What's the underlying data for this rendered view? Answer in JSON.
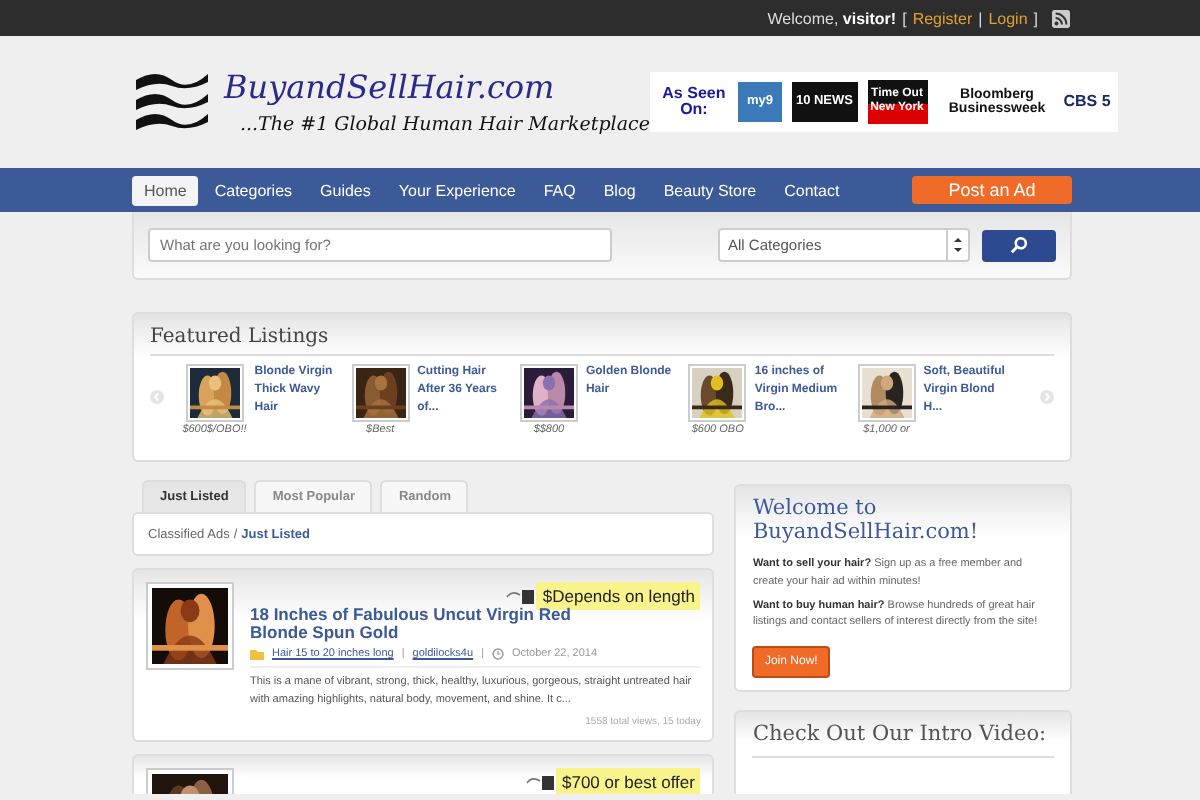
{
  "top_bar": {
    "welcome": "Welcome, **visitor!**",
    "open_bracket": "[",
    "register": "Register",
    "separator": "|",
    "login": "Login",
    "close_bracket": "]"
  },
  "header": {
    "logo_title": "BuyandSellHair.com",
    "tagline": "...The #1 Global Human Hair Marketplace",
    "as_seen_on": "As Seen On:",
    "media_logos": [
      {
        "kind": "my9",
        "text": "my9"
      },
      {
        "kind": "news",
        "text": "10 NEWS"
      },
      {
        "kind": "timeout",
        "text": "Time Out New York"
      },
      {
        "kind": "bloomberg",
        "text": "Bloomberg Businessweek"
      },
      {
        "kind": "cbs",
        "text": "CBS 5"
      }
    ]
  },
  "nav": {
    "items": [
      {
        "label": "Home",
        "selected": true
      },
      {
        "label": "Categories",
        "selected": false
      },
      {
        "label": "Guides",
        "selected": false
      },
      {
        "label": "Your Experience",
        "selected": false
      },
      {
        "label": "FAQ",
        "selected": false
      },
      {
        "label": "Blog",
        "selected": false
      },
      {
        "label": "Beauty Store",
        "selected": false
      },
      {
        "label": "Contact",
        "selected": false
      }
    ],
    "post_ad": "Post an Ad"
  },
  "search": {
    "placeholder": "What are you looking for?",
    "category": "All Categories"
  },
  "featured": {
    "title": "Featured Listings",
    "items": [
      {
        "title": "Blonde Virgin Thick Wavy Hair",
        "price": "$600$/OBO!!"
      },
      {
        "title": "Cutting Hair After 36 Years of...",
        "price": "$Best"
      },
      {
        "title": "Golden Blonde Hair",
        "price": "$$800"
      },
      {
        "title": "16 inches of Virgin Medium Bro...",
        "price": "$600 OBO"
      },
      {
        "title": "Soft, Beautiful Virgin Blond H...",
        "price": "$1,000 or"
      }
    ]
  },
  "tabs": [
    {
      "label": "Just Listed",
      "selected": true
    },
    {
      "label": "Most Popular",
      "selected": false
    },
    {
      "label": "Random",
      "selected": false
    }
  ],
  "breadcrumb": {
    "root": "Classified Ads",
    "separator": "/",
    "current": "Just Listed"
  },
  "listings": [
    {
      "price": "$Depends on length",
      "title": "18 Inches of Fabulous Uncut Virgin Red Blonde Spun Gold",
      "category": "Hair 15 to 20 inches long",
      "divider": "|",
      "author": "goldilocks4u",
      "date": "October 22, 2014",
      "excerpt": "This is a mane of vibrant, strong, thick, healthy, luxurious, gorgeous, straight untreated hair with amazing highlights, natural body, movement, and shine. It c...",
      "views": "1558 total views, 15 today"
    },
    {
      "price": "$700 or best offer"
    }
  ],
  "sidebar": {
    "welcome_title": "Welcome to BuyandSellHair.com!",
    "paragraphs": [
      "**Want to sell your hair?** Sign up as a free member and create your hair ad within minutes!",
      "**Want to buy human hair?** Browse hundreds of great hair listings and contact sellers of interest directly from the site!"
    ],
    "join_button": "Join Now!",
    "video_title": "Check Out Our Intro Video:"
  }
}
